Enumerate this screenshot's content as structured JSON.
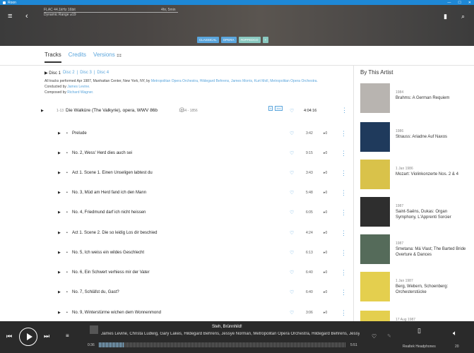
{
  "window": {
    "title": "Roon"
  },
  "banner": {
    "format": "FLAC 44.1kHz 16bit",
    "dynamic_range": "Dynamic Range ⌀19",
    "duration": "4hr, 5min",
    "tags": [
      "CLASSICAL",
      "OPERA",
      "#OPPEDCO"
    ]
  },
  "tabs": [
    "Tracks",
    "Credits",
    "Versions"
  ],
  "discs": {
    "current": "Disc 1",
    "others": [
      "Disc 2",
      "Disc 3",
      "Disc 4"
    ]
  },
  "notes": {
    "performed": "All tracks performed Apr 1987, Manhattan Center, New York, NY, by",
    "performers": [
      "Metropolitan Opera Orchestra,",
      "Hildegard Behrens,",
      "James Morris,",
      "Kurt Moll,",
      "Metropolitan Opera Orchestra."
    ],
    "conducted_prefix": "Conducted by",
    "conductor": "James Levine.",
    "composed_prefix": "Composed by",
    "composer": "Richard Wagner."
  },
  "work": {
    "range": "1-13",
    "title": "Die Walküre (The Valkyrie), opera, WWV 86b",
    "years": "1854 - 1856",
    "badge1": "5",
    "badge2": "366",
    "duration": "4:04:16"
  },
  "tracks": [
    {
      "title": "Prelude",
      "duration": "3:42",
      "plays": "0"
    },
    {
      "title": "No. 2, Wess' Herd dies auch sei",
      "duration": "9:15",
      "plays": "0"
    },
    {
      "title": "Act 1. Scene 1. Einen Unseligen labtest du",
      "duration": "3:43",
      "plays": "0"
    },
    {
      "title": "No. 3, Müd am Herd fand ich den Mann",
      "duration": "5:48",
      "plays": "0"
    },
    {
      "title": "No. 4, Friedmund darf ich nicht heissen",
      "duration": "6:05",
      "plays": "0"
    },
    {
      "title": "Act 1. Scene 2. Die so leidig Los dir beschied",
      "duration": "4:24",
      "plays": "0"
    },
    {
      "title": "No. 5, Ich weiss ein wildes Geschlecht",
      "duration": "6:13",
      "plays": "0"
    },
    {
      "title": "No. 6, Ein Schwert verhiess mir der Vater",
      "duration": "6:40",
      "plays": "0"
    },
    {
      "title": "No. 7, Schläfst du, Gast?",
      "duration": "6:40",
      "plays": "0"
    },
    {
      "title": "No. 9, Winterstürme wichen dem Wonnenmond",
      "duration": "3:06",
      "plays": "0"
    }
  ],
  "sidebar": {
    "title": "By This Artist",
    "items": [
      {
        "date": "1984",
        "title": "Brahms: A German Requiem",
        "color": "#b8b4b0"
      },
      {
        "date": "1986",
        "title": "Strauss: Ariadne Auf Naxos",
        "color": "#1f3a5c"
      },
      {
        "date": "1 Jan 1986",
        "title": "Mozart: Violinkonzerte Nos. 2 & 4",
        "color": "#d9c24a"
      },
      {
        "date": "1987",
        "title": "Saint-Saëns, Dukas: Organ Symphony, L'Apprenti Sorcier",
        "color": "#2e2e2e"
      },
      {
        "date": "1987",
        "title": "Smetana: Má Vlast; The Barted Bride Overture & Dances",
        "color": "#556b5a"
      },
      {
        "date": "1 Jan 1987",
        "title": "Berg, Webern, Schoenberg: Orchesterstücke",
        "color": "#e4cf4e"
      },
      {
        "date": "17 Aug 1987",
        "title": "",
        "color": "#e4cf4e"
      }
    ]
  },
  "player": {
    "now_playing": "Steh, Brünnhild!",
    "artists": "James Levine, Christa Ludwig, Gary Lakes, Hildegard Behrens, Jessye Norman, Metropolitan Opera Orchestra, Hildegard Behrens, Jessye Norman, Metropolitan Opera Orchestra",
    "elapsed": "0:36",
    "total": "5:51",
    "progress": 0.1,
    "zone": "Realtek Headphones",
    "volume": "20"
  }
}
